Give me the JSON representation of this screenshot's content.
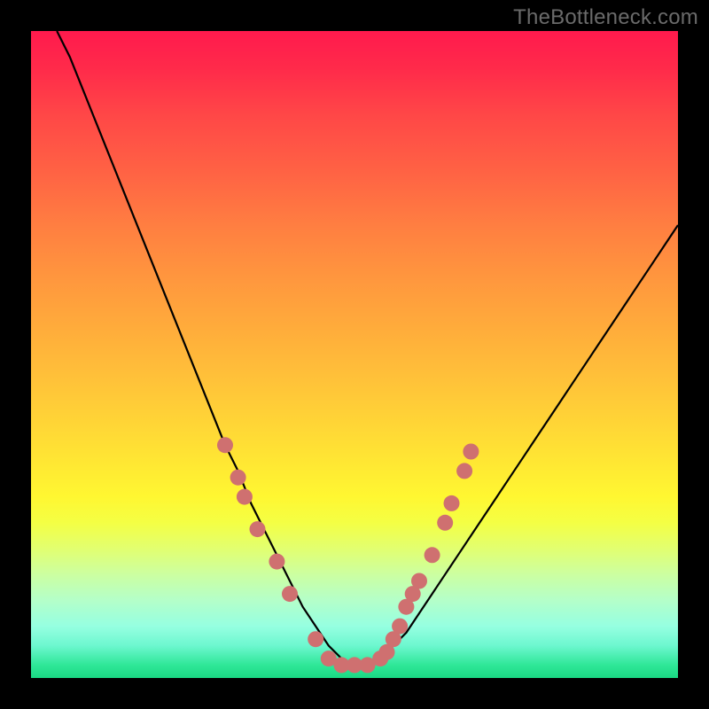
{
  "watermark": "TheBottleneck.com",
  "colors": {
    "frame": "#000000",
    "curve": "#000000",
    "marker": "#cf7070",
    "gradient_top": "#ff1a4d",
    "gradient_bottom": "#1ad983"
  },
  "chart_data": {
    "type": "line",
    "title": "",
    "xlabel": "",
    "ylabel": "",
    "xlim": [
      0,
      100
    ],
    "ylim": [
      0,
      100
    ],
    "grid": false,
    "legend": false,
    "x": [
      4,
      6,
      8,
      10,
      12,
      14,
      16,
      18,
      20,
      22,
      24,
      26,
      28,
      30,
      32,
      34,
      36,
      38,
      40,
      42,
      44,
      46,
      48,
      50,
      52,
      54,
      56,
      58,
      60,
      62,
      64,
      66,
      68,
      70,
      72,
      74,
      76,
      78,
      80,
      82,
      84,
      86,
      88,
      90,
      92,
      94,
      96,
      98,
      100
    ],
    "y": [
      100,
      96,
      91,
      86,
      81,
      76,
      71,
      66,
      61,
      56,
      51,
      46,
      41,
      36,
      32,
      27,
      23,
      19,
      15,
      11,
      8,
      5,
      3,
      2,
      2,
      3,
      5,
      7,
      10,
      13,
      16,
      19,
      22,
      25,
      28,
      31,
      34,
      37,
      40,
      43,
      46,
      49,
      52,
      55,
      58,
      61,
      64,
      67,
      70
    ],
    "series": [
      {
        "name": "bottleneck-curve",
        "is_marker_series": false
      },
      {
        "name": "highlighted-points",
        "is_marker_series": true,
        "marker_radius": 9,
        "points": [
          {
            "x": 30,
            "y": 36
          },
          {
            "x": 32,
            "y": 31
          },
          {
            "x": 33,
            "y": 28
          },
          {
            "x": 35,
            "y": 23
          },
          {
            "x": 38,
            "y": 18
          },
          {
            "x": 40,
            "y": 13
          },
          {
            "x": 44,
            "y": 6
          },
          {
            "x": 46,
            "y": 3
          },
          {
            "x": 48,
            "y": 2
          },
          {
            "x": 50,
            "y": 2
          },
          {
            "x": 52,
            "y": 2
          },
          {
            "x": 54,
            "y": 3
          },
          {
            "x": 55,
            "y": 4
          },
          {
            "x": 56,
            "y": 6
          },
          {
            "x": 57,
            "y": 8
          },
          {
            "x": 58,
            "y": 11
          },
          {
            "x": 59,
            "y": 13
          },
          {
            "x": 60,
            "y": 15
          },
          {
            "x": 62,
            "y": 19
          },
          {
            "x": 64,
            "y": 24
          },
          {
            "x": 65,
            "y": 27
          },
          {
            "x": 67,
            "y": 32
          },
          {
            "x": 68,
            "y": 35
          }
        ]
      }
    ]
  }
}
